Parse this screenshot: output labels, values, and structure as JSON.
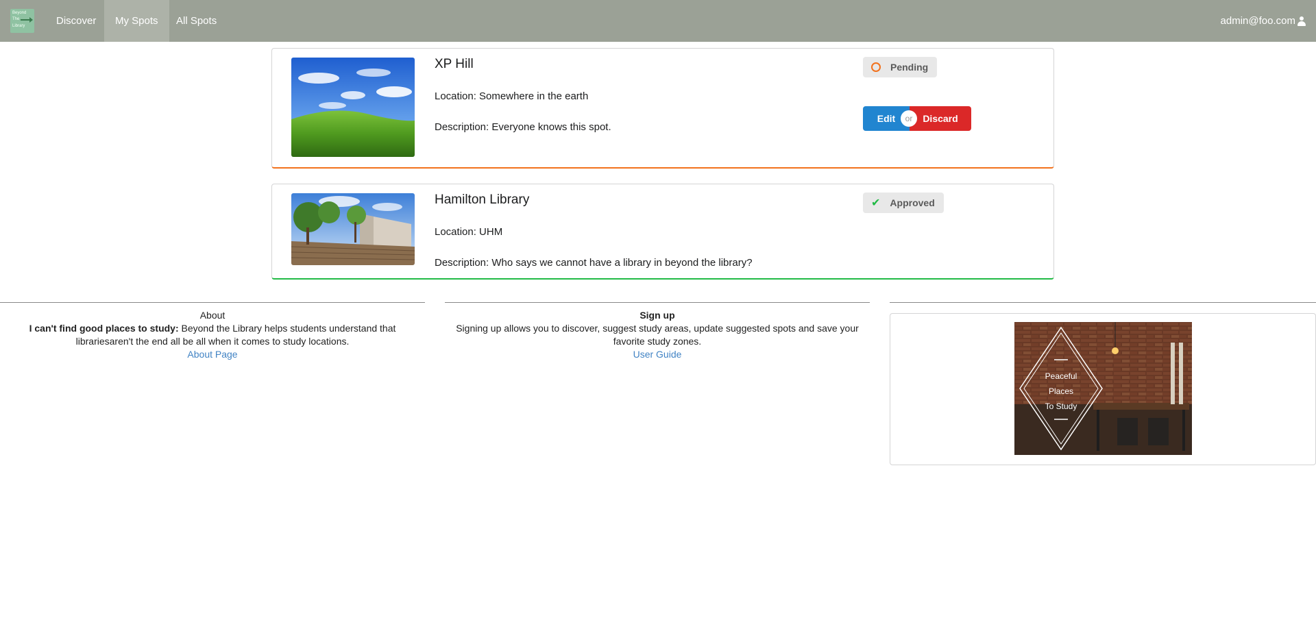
{
  "nav": {
    "logo_lines": [
      "Beyond",
      "The",
      "Library"
    ],
    "items": [
      {
        "label": "Discover",
        "active": false
      },
      {
        "label": "My Spots",
        "active": true
      },
      {
        "label": "All Spots",
        "active": false
      }
    ],
    "user_email": "admin@foo.com"
  },
  "spots": [
    {
      "title": "XP Hill",
      "location": "Location: Somewhere in the earth",
      "description": "Description: Everyone knows this spot.",
      "status": "Pending",
      "status_color": "#f2711c",
      "actions": {
        "edit": "Edit",
        "or": "or",
        "discard": "Discard"
      }
    },
    {
      "title": "Hamilton Library",
      "location": "Location: UHM",
      "description": "Description: Who says we cannot have a library in beyond the library?",
      "status": "Approved",
      "status_color": "#21ba45"
    }
  ],
  "footer": {
    "about": {
      "heading": "About",
      "bold_lead": "I can't find good places to study:",
      "text": " Beyond the Library helps students understand that librariesaren't the end all be all when it comes to study locations.",
      "link": "About Page"
    },
    "signup": {
      "heading": "Sign up",
      "text": "Signing up allows you to discover, suggest study areas, update suggested spots and save your favorite study zones.",
      "link": "User Guide"
    },
    "banner": {
      "lines": [
        "Peaceful",
        "Places",
        "To Study"
      ]
    }
  },
  "colors": {
    "navbar": "#9ba196",
    "primary": "#2185d0",
    "danger": "#db2828",
    "pending": "#f2711c",
    "approved": "#21ba45",
    "link": "#4183c4"
  }
}
